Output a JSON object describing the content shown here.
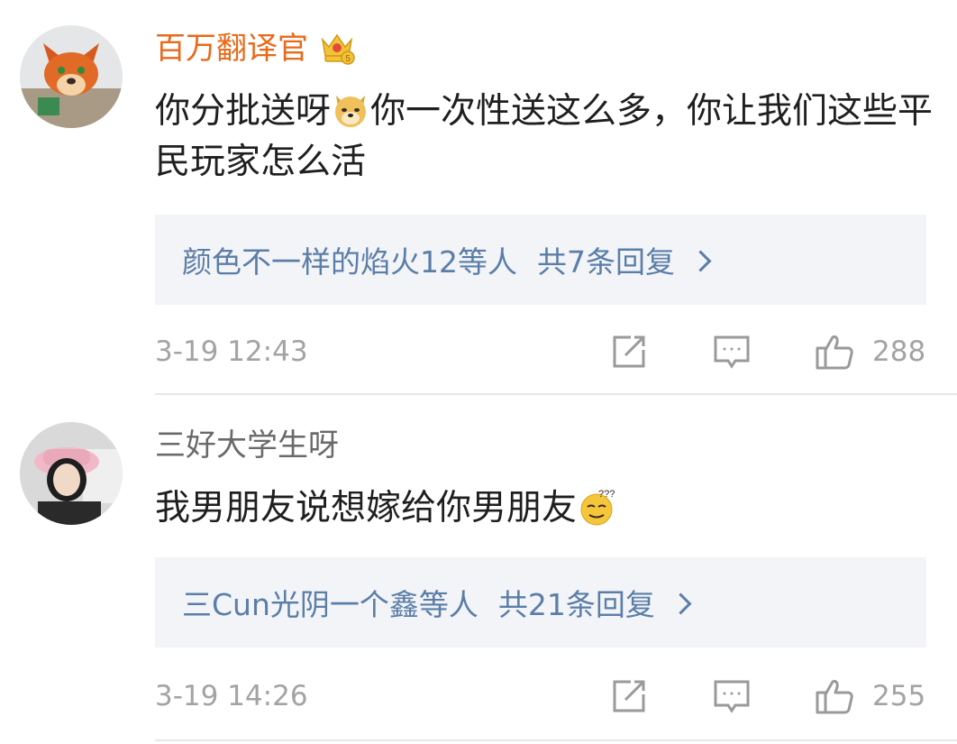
{
  "colors": {
    "vip_username": "#e86a1a",
    "normal_username": "#6a6a6a",
    "reply_link": "#5b7ea8",
    "meta_gray": "#a3a3a3",
    "reply_bg": "#f3f4f7"
  },
  "comments": [
    {
      "username": "百万翻译官",
      "badge_icon": "vip-crown-icon",
      "text_before_emoji": "你分批送呀",
      "emoji_icon": "doge-emoji-icon",
      "text_after_emoji": "你一次性送这么多，你让我们这些平民玩家怎么活",
      "reply_names": "颜色不一样的焰火12等人",
      "reply_count": "共7条回复",
      "time": "3-19 12:43",
      "likes": "288"
    },
    {
      "username": "三好大学生呀",
      "text_before_emoji": "我男朋友说想嫁给你男朋友",
      "emoji_icon": "confused-emoji-icon",
      "text_after_emoji": "",
      "reply_names": "三Cun光阴一个鑫等人",
      "reply_count": "共21条回复",
      "time": "3-19 14:26",
      "likes": "255"
    }
  ]
}
